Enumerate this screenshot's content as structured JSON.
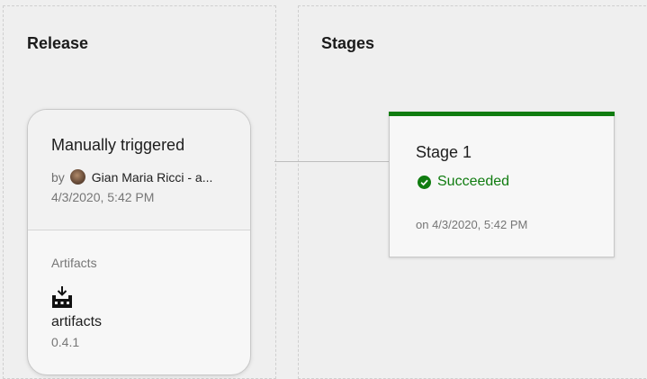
{
  "release_panel": {
    "title": "Release",
    "card": {
      "trigger": "Manually triggered",
      "by_prefix": "by",
      "user": "Gian Maria Ricci - a...",
      "date": "4/3/2020, 5:42 PM",
      "artifacts_label": "Artifacts",
      "artifact": {
        "icon": "build-artifact-icon",
        "name": "artifacts",
        "version": "0.4.1"
      }
    }
  },
  "stages_panel": {
    "title": "Stages",
    "stage": {
      "name": "Stage 1",
      "status": "Succeeded",
      "status_icon": "check-circle-icon",
      "date": "on 4/3/2020, 5:42 PM",
      "accent_color": "#107c10"
    }
  }
}
